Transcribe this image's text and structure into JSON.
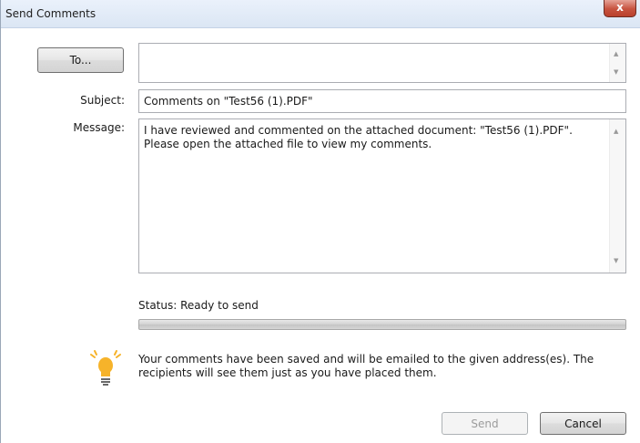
{
  "window": {
    "title": "Send Comments",
    "close_label": "x"
  },
  "to": {
    "button_label": "To...",
    "value": ""
  },
  "subject": {
    "label": "Subject:",
    "value": "Comments on \"Test56 (1).PDF\""
  },
  "message": {
    "label": "Message:",
    "value": "I have reviewed and commented on the attached document: \"Test56 (1).PDF\".\nPlease open the attached file to view my comments."
  },
  "status": {
    "text": "Status: Ready to send",
    "progress": 0
  },
  "info": {
    "icon": "lightbulb-icon",
    "text": "Your comments have been saved and will be emailed to the given address(es). The recipients will see them just as you have placed them."
  },
  "actions": {
    "send_label": "Send",
    "send_enabled": false,
    "cancel_label": "Cancel"
  },
  "colors": {
    "accent": "#3fb24a",
    "bulb": "#f6b32a"
  }
}
